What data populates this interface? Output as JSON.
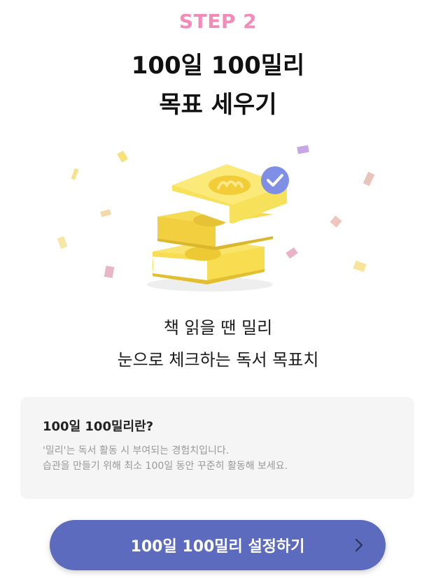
{
  "header": {
    "step": "STEP 2",
    "title_line1": "100일 100밀리",
    "title_line2": "목표 세우기"
  },
  "description": {
    "line1": "책 읽을 땐 밀리",
    "line2": "눈으로 체크하는 독서 목표치"
  },
  "info": {
    "title": "100일 100밀리란?",
    "line1": "'밀리'는 독서 활동 시 부여되는 경험치입니다.",
    "line2": "습관을 만들기 위해 최소 100일 동안 꾸준히 활동해 보세요."
  },
  "cta": {
    "label": "100일 100밀리 설정하기"
  },
  "colors": {
    "accent_pink": "#f38bb9",
    "button_blue": "#5d6bbf",
    "book_yellow": "#f7dd4f",
    "check_badge": "#7f8fe6"
  },
  "icons": {
    "book_stack": "book-stack-icon",
    "check": "check-icon",
    "chevron": "chevron-right-icon"
  }
}
